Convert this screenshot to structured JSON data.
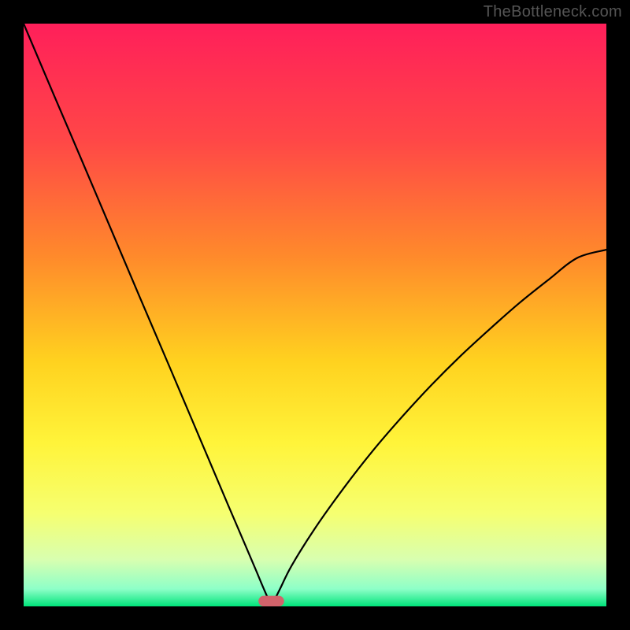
{
  "watermark": "TheBottleneck.com",
  "chart_data": {
    "type": "line",
    "title": "",
    "xlabel": "",
    "ylabel": "",
    "xlim": [
      0,
      100
    ],
    "ylim": [
      0,
      100
    ],
    "x": [
      0,
      5,
      10,
      15,
      20,
      25,
      30,
      35,
      38,
      40,
      41,
      42,
      42.5,
      43,
      44,
      46,
      50,
      55,
      60,
      65,
      70,
      75,
      80,
      85,
      90,
      95,
      100
    ],
    "values": [
      100,
      88.2,
      76.5,
      64.7,
      52.9,
      41.2,
      29.4,
      17.6,
      10.6,
      5.9,
      3.5,
      1.2,
      0,
      1.0,
      3.0,
      7.0,
      13.4,
      20.4,
      26.8,
      32.6,
      38.0,
      43.0,
      47.6,
      52.0,
      56.0,
      59.8,
      61.2
    ],
    "gradient_stops": [
      {
        "offset": 0.0,
        "color": "#ff1f5a"
      },
      {
        "offset": 0.2,
        "color": "#ff4747"
      },
      {
        "offset": 0.4,
        "color": "#ff8a2b"
      },
      {
        "offset": 0.58,
        "color": "#ffd21f"
      },
      {
        "offset": 0.72,
        "color": "#fff43a"
      },
      {
        "offset": 0.84,
        "color": "#f6ff70"
      },
      {
        "offset": 0.92,
        "color": "#d8ffb0"
      },
      {
        "offset": 0.97,
        "color": "#8effc8"
      },
      {
        "offset": 1.0,
        "color": "#00e47a"
      }
    ],
    "marker": {
      "x": 42.5,
      "y": 0,
      "rx": 2.2,
      "ry": 0.9,
      "color": "#d1636b"
    }
  }
}
